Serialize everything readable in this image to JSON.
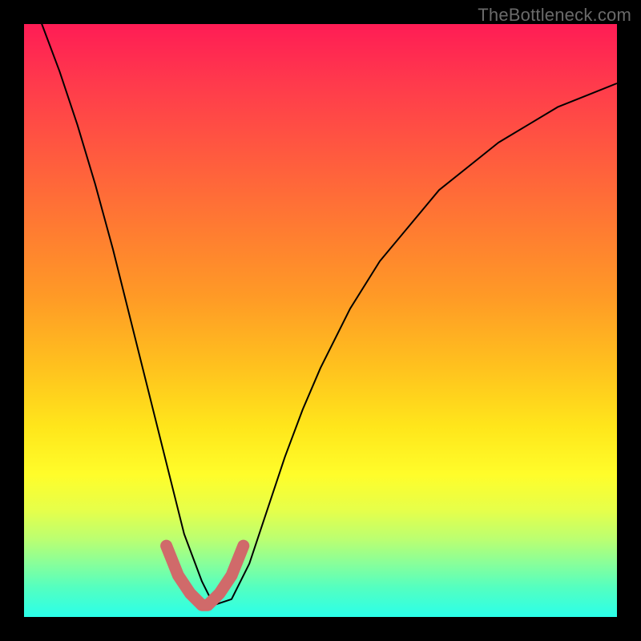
{
  "watermark": "TheBottleneck.com",
  "chart_data": {
    "type": "line",
    "title": "",
    "xlabel": "",
    "ylabel": "",
    "xlim": [
      0,
      1
    ],
    "ylim": [
      0,
      1
    ],
    "x": [
      0.0,
      0.03,
      0.06,
      0.09,
      0.12,
      0.15,
      0.18,
      0.21,
      0.24,
      0.27,
      0.3,
      0.32,
      0.35,
      0.38,
      0.41,
      0.44,
      0.47,
      0.5,
      0.55,
      0.6,
      0.65,
      0.7,
      0.75,
      0.8,
      0.85,
      0.9,
      0.95,
      1.0
    ],
    "values": [
      1.07,
      1.0,
      0.92,
      0.83,
      0.73,
      0.62,
      0.5,
      0.38,
      0.26,
      0.14,
      0.06,
      0.02,
      0.03,
      0.09,
      0.18,
      0.27,
      0.35,
      0.42,
      0.52,
      0.6,
      0.66,
      0.72,
      0.76,
      0.8,
      0.83,
      0.86,
      0.88,
      0.9
    ],
    "highlight_segment": {
      "x": [
        0.24,
        0.26,
        0.28,
        0.3,
        0.31,
        0.33,
        0.35,
        0.37
      ],
      "values": [
        0.12,
        0.07,
        0.04,
        0.02,
        0.02,
        0.04,
        0.07,
        0.12
      ]
    },
    "gradient_stops": [
      {
        "pos": 0.0,
        "color": "#ff1c55"
      },
      {
        "pos": 0.22,
        "color": "#ff5a3f"
      },
      {
        "pos": 0.46,
        "color": "#ff9a26"
      },
      {
        "pos": 0.68,
        "color": "#ffe61b"
      },
      {
        "pos": 0.82,
        "color": "#e6ff4a"
      },
      {
        "pos": 0.95,
        "color": "#54ffc0"
      },
      {
        "pos": 1.0,
        "color": "#2affea"
      }
    ]
  }
}
